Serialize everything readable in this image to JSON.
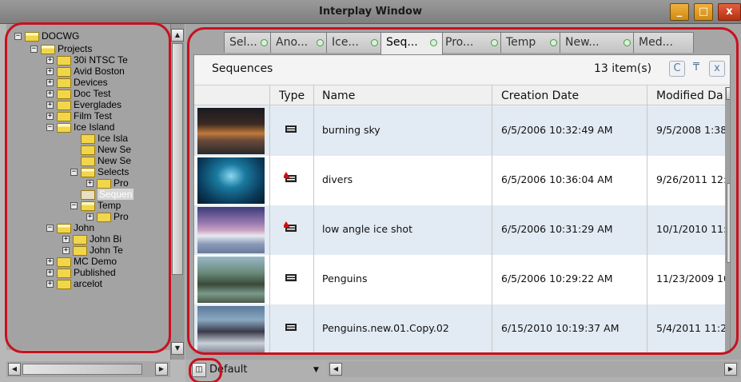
{
  "window": {
    "title": "Interplay Window",
    "min_glyph": "_",
    "max_glyph": "□",
    "close_glyph": "x"
  },
  "tree": {
    "items": [
      {
        "label": "DOCWG",
        "expander": "−"
      },
      {
        "label": "Projects",
        "expander": "−"
      },
      {
        "label": "30i NTSC Te",
        "expander": "+"
      },
      {
        "label": "Avid Boston",
        "expander": "+"
      },
      {
        "label": "Devices",
        "expander": "+"
      },
      {
        "label": "Doc Test",
        "expander": "+"
      },
      {
        "label": "Everglades",
        "expander": "+"
      },
      {
        "label": "Film Test",
        "expander": "+"
      },
      {
        "label": "Ice Island",
        "expander": "−"
      },
      {
        "label": "Ice Isla",
        "expander": ""
      },
      {
        "label": "New Se",
        "expander": ""
      },
      {
        "label": "New Se",
        "expander": ""
      },
      {
        "label": "Selects",
        "expander": "−"
      },
      {
        "label": "Pro",
        "expander": "+"
      },
      {
        "label": "Sequen",
        "expander": ""
      },
      {
        "label": "Temp",
        "expander": "−"
      },
      {
        "label": "Pro",
        "expander": "+"
      },
      {
        "label": "John",
        "expander": "−"
      },
      {
        "label": "John Bi",
        "expander": "+"
      },
      {
        "label": "John Te",
        "expander": "+"
      },
      {
        "label": "MC Demo",
        "expander": "+"
      },
      {
        "label": "Published",
        "expander": "+"
      },
      {
        "label": "arcelot",
        "expander": "+"
      }
    ]
  },
  "tabs": [
    {
      "label": "Sel..."
    },
    {
      "label": "Ano..."
    },
    {
      "label": "Ice..."
    },
    {
      "label": "Seq..."
    },
    {
      "label": "Pro..."
    },
    {
      "label": "Temp"
    },
    {
      "label": "New..."
    },
    {
      "label": "Med..."
    }
  ],
  "panel": {
    "title": "Sequences",
    "count": "13 item(s)",
    "refresh_glyph": "C",
    "pin_glyph": "₸",
    "close_glyph": "x"
  },
  "columns": {
    "type": "Type",
    "name": "Name",
    "creation": "Creation Date",
    "modified": "Modified Da"
  },
  "rows": [
    {
      "name": "burning sky",
      "creation": "6/5/2006 10:32:49 AM",
      "modified": "9/5/2008 1:38",
      "flag": false
    },
    {
      "name": "divers",
      "creation": "6/5/2006 10:36:04 AM",
      "modified": "9/26/2011 12:",
      "flag": true
    },
    {
      "name": "low angle ice shot",
      "creation": "6/5/2006 10:31:29 AM",
      "modified": "10/1/2010 11:",
      "flag": true
    },
    {
      "name": "Penguins",
      "creation": "6/5/2006 10:29:22 AM",
      "modified": "11/23/2009 10",
      "flag": false
    },
    {
      "name": "Penguins.new.01.Copy.02",
      "creation": "6/15/2010 10:19:37 AM",
      "modified": "5/4/2011 11:2",
      "flag": false
    }
  ],
  "footer": {
    "layout_label": "Default",
    "layout_glyph": "◫",
    "dropdown_glyph": "▼"
  },
  "icons": {
    "sequence": "sequence-icon",
    "folder": "folder-icon"
  },
  "colors": {
    "accent_red": "#c8101e",
    "row_alt": "#e2eaf3",
    "folder": "#f2d64a"
  }
}
